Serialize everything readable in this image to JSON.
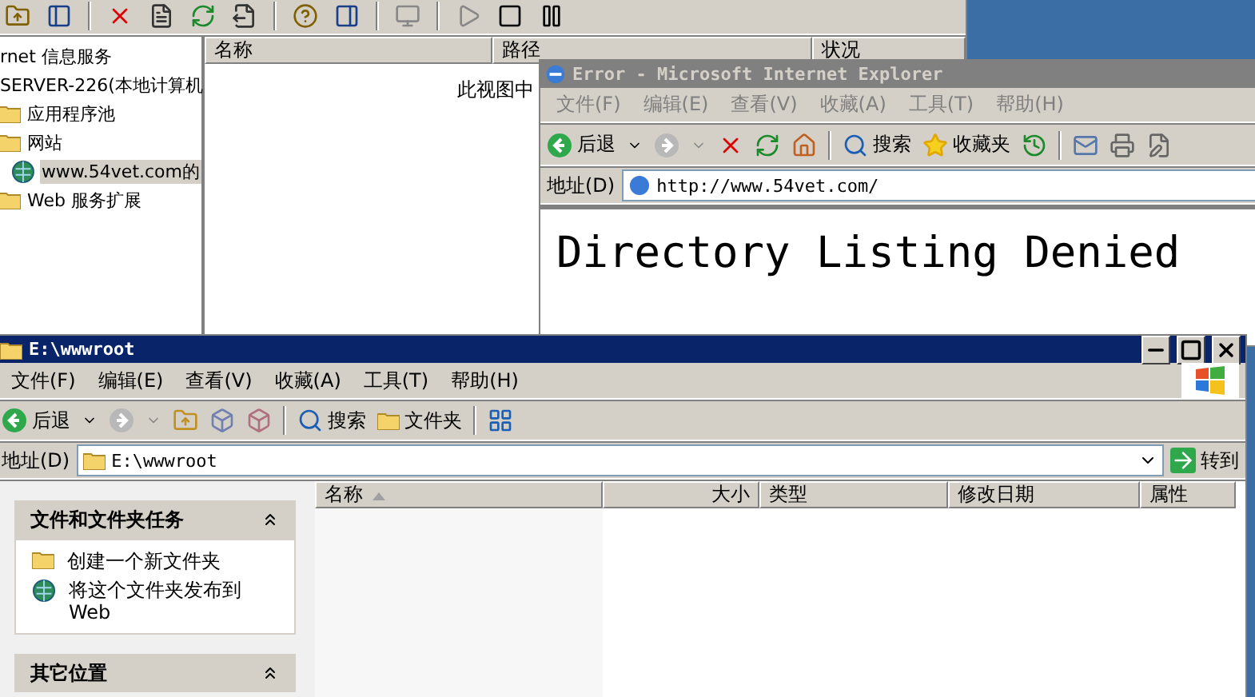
{
  "iis_window": {
    "tree": [
      {
        "label": "rnet 信息服务",
        "selected": false,
        "children": [
          {
            "label": "SERVER-226(本地计算机",
            "selected": false,
            "children": [
              {
                "label": "应用程序池",
                "kind": "folder",
                "selected": false
              },
              {
                "label": "网站",
                "kind": "folder",
                "selected": false,
                "children": [
                  {
                    "label": "www.54vet.com的",
                    "kind": "site",
                    "selected": true
                  }
                ]
              },
              {
                "label": "Web 服务扩展",
                "kind": "folder",
                "selected": false
              }
            ]
          }
        ]
      }
    ],
    "columns": [
      "名称",
      "路径",
      "状况"
    ],
    "empty_message": "此视图中"
  },
  "ie_window": {
    "title": "Error - Microsoft Internet Explorer",
    "active": false,
    "menu": [
      "文件(F)",
      "编辑(E)",
      "查看(V)",
      "收藏(A)",
      "工具(T)",
      "帮助(H)"
    ],
    "back": "后退",
    "search": "搜索",
    "favorites": "收藏夹",
    "address_label": "地址(D)",
    "address": "http://www.54vet.com/",
    "heading": "Directory Listing Denied"
  },
  "explorer_window": {
    "title": "E:\\wwwroot",
    "active": true,
    "menu": [
      "文件(F)",
      "编辑(E)",
      "查看(V)",
      "收藏(A)",
      "工具(T)",
      "帮助(H)"
    ],
    "back": "后退",
    "search": "搜索",
    "folders": "文件夹",
    "address_label": "地址(D)",
    "address": "E:\\wwwroot",
    "go": "转到",
    "task_panels": [
      {
        "title": "文件和文件夹任务",
        "items": [
          {
            "label": "创建一个新文件夹",
            "kind": "new-folder"
          },
          {
            "label": "将这个文件夹发布到 Web",
            "kind": "publish"
          }
        ]
      },
      {
        "title": "其它位置"
      }
    ],
    "columns": [
      {
        "label": "名称",
        "sorted": true
      },
      {
        "label": "大小",
        "sorted": false
      },
      {
        "label": "类型",
        "sorted": false
      },
      {
        "label": "修改日期",
        "sorted": false
      },
      {
        "label": "属性",
        "sorted": false
      }
    ]
  }
}
